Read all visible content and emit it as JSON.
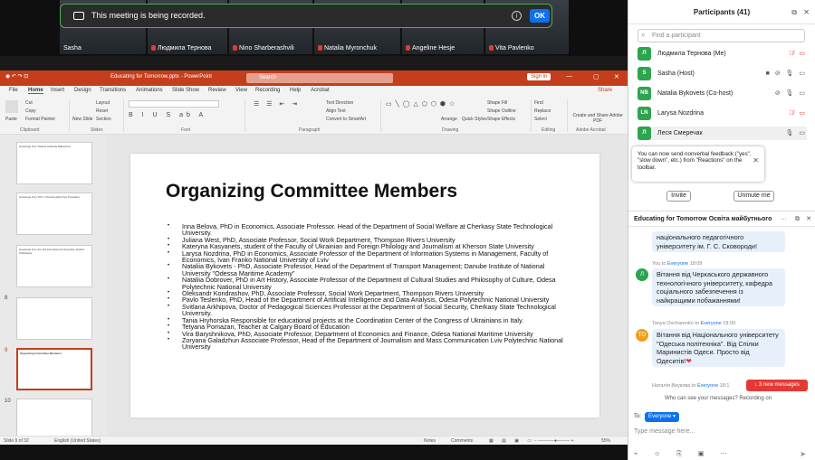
{
  "meeting": {
    "tiles": [
      {
        "name": "Sasha",
        "muted": false
      },
      {
        "name": "Людмила Тернова",
        "muted": true
      },
      {
        "name": "Nino Sharberashvili",
        "muted": true
      },
      {
        "name": "Natalia Myronchuk",
        "muted": true
      },
      {
        "name": "Angeline Hesje",
        "muted": true
      },
      {
        "name": "Vita Pavlenko",
        "muted": true
      }
    ],
    "recording_text": "This meeting is being recorded.",
    "ok_label": "OK"
  },
  "ppt": {
    "doc_title": "Educating for Tomorrow.pptx - PowerPoint",
    "search_placeholder": "Search",
    "sign_in": "Sign in",
    "share": "Share",
    "menu": [
      "File",
      "Home",
      "Insert",
      "Design",
      "Transitions",
      "Animations",
      "Slide Show",
      "Review",
      "View",
      "Recording",
      "Help",
      "Acrobat"
    ],
    "ribbon_groups": [
      "Clipboard",
      "Slides",
      "Font",
      "Paragraph",
      "Drawing",
      "Editing",
      "Adobe Acrobat"
    ],
    "ribbon": {
      "paste": "Paste",
      "cut": "Cut",
      "copy": "Copy",
      "format_painter": "Format Painter",
      "new_slide": "New Slide",
      "layout": "Layout",
      "reset": "Reset",
      "section": "Section",
      "text_direction": "Text Direction",
      "align_text": "Align Text",
      "convert_smartart": "Convert to SmartArt",
      "arrange": "Arrange",
      "quick_styles": "Quick Styles",
      "shape_fill": "Shape Fill",
      "shape_outline": "Shape Outline",
      "shape_effects": "Shape Effects",
      "find": "Find",
      "replace": "Replace",
      "select": "Select",
      "create_share": "Create and Share Adobe PDF"
    },
    "thumbs": [
      {
        "num": "",
        "title": "Greetings from Tatiana Andreas Makydova"
      },
      {
        "num": "",
        "title": "Greetings from TPU / Khmelnytskyi Kyiv President"
      },
      {
        "num": "",
        "title": "Greetings from the 3rd International University Joshua Kubbisava"
      },
      {
        "num": "8",
        "title": ""
      },
      {
        "num": "9",
        "title": "Organizing Committee Members"
      },
      {
        "num": "10",
        "title": ""
      }
    ],
    "slide_title": "Organizing Committee Members",
    "members": [
      "Inna Belova, PhD in Economics, Associate Professor. Head of the Department of Social Welfare  at Cherkasy State Technological University.",
      "Juliana West, PhD, Associate Professor, Social Work Department, Thompson Rivers University",
      "Kateryna Kasyanets, student of the Faculty of Ukrainian and Foreign Philology and Journalism at Kherson State University",
      "Larysa Nozdrina, PhD in Economics, Associate Professor of the Department of Information Systems in Management, Faculty of Economics, Ivan Franko National University of Lviv",
      "Nataliia Bykovets - PhD, Associate Professor, Head of the Department of Transport Management; Danube Institute of National University \"Odessa Maritime Academy\"",
      "Nataliia Dobrover, PhD in Art History, Associate Professor of the Department of Cultural Studies and Philosophy of Culture, Odesa Polytechnic National University",
      "Oleksandr Kondrashov, PhD, Associate Professor, Social Work Department, Thompson Rivers University",
      "Pavlo Teslenko, PhD, Head of the Department of Artificial Intelligence and Data Analysis, Odesa Polytechnic National University",
      "Svitlana Arkhipova, Doctor of Pedagogical Sciences Professor at the Department of Social Security, Cherkasy State Technological University.",
      "Tania Hryhorska Responsible for educational projects at the Coordination Center of the Congress of Ukrainians in Italy.",
      "Tetyana Pomazan,  Teacher at Calgary Board of Education",
      "Vira Baryshnikova, PhD, Associate Professor, Department of Economics and Finance, Odesa National Maritime University",
      "Zoryana Galadzhun Associate Professor, Head of the Department of Journalism and Mass Communication Lviv Polytechnic National University"
    ],
    "status": {
      "slide": "Slide 9 of 32",
      "lang": "English (United States)",
      "notes": "Notes",
      "comments": "Comments",
      "zoom": "55%"
    }
  },
  "participants": {
    "title": "Participants (41)",
    "search_placeholder": "Find a participant",
    "list": [
      {
        "initials": "Л",
        "name": "Людмила Тернова (Me)",
        "color": "#2da44e"
      },
      {
        "initials": "S",
        "name": "Sasha (Host)",
        "color": "#2da44e"
      },
      {
        "initials": "NB",
        "name": "Natalia Bykovets (Co-host)",
        "color": "#2da44e"
      },
      {
        "initials": "LN",
        "name": "Larysa Nozdrina",
        "color": "#2da44e"
      },
      {
        "initials": "Л",
        "name": "Леся Смеречак",
        "color": "#2da44e"
      }
    ],
    "tip": "You can now send nonverbal feedback (\"yes\", \"slow down\", etc.) from \"Reactions\" on the toolbar.",
    "invite": "Invite",
    "unmute_me": "Unmute me"
  },
  "chat": {
    "title": "Educating for Tomorrow Освіта майбутнього",
    "messages": [
      {
        "meta": "",
        "text": "національного педагогічного університету ім. Г. С. Сковороди!"
      },
      {
        "meta_from": "You",
        "meta_to": "Everyone",
        "time": "18:09",
        "avatar": "Л",
        "text": "Вітання від Черкаського державного технологічного університету, кафедра соціального забезпечення із найкращими побажаннями!"
      },
      {
        "meta_from": "Tanya Ovcharenko",
        "meta_to": "Everyone",
        "time": "18:09",
        "avatar": "TO",
        "text": "Вітання від Національного університету \"Одеська політехніка\". Від Спілки Маринистів Одеси. Просто від Одеситів!"
      },
      {
        "meta_from": "Наталія Виукова",
        "meta_to": "Everyone",
        "time": "18:1",
        "avatar": "",
        "text": ""
      }
    ],
    "new_messages": "3 new messages",
    "who_can_see": "Who can see your messages? Recording on",
    "to_label": "To:",
    "to_value": "Everyone",
    "input_placeholder": "Type message here..."
  }
}
